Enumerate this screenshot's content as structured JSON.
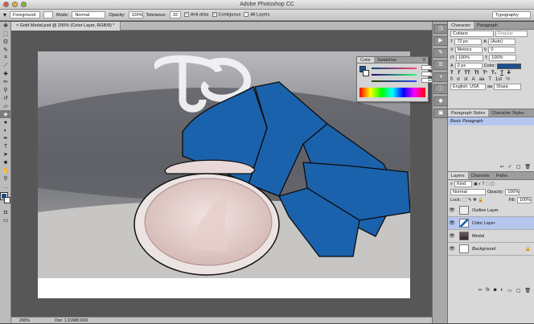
{
  "window": {
    "title": "Adobe Photoshop CC"
  },
  "options_bar": {
    "mode_preset": "Foreground",
    "mode_label": "Mode:",
    "mode_value": "Normal",
    "opacity_label": "Opacity:",
    "opacity_value": "100%",
    "tolerance_label": "Tolerance:",
    "tolerance_value": "32",
    "anti_alias": "Anti-alias",
    "contiguous": "Contiguous",
    "all_layers": "All Layers",
    "workspace": "Typography"
  },
  "document": {
    "tab_title": "Gold Medal.psd @ 200% (Color Layer, RGB/8) *",
    "zoom": "200%",
    "doc_size": "Doc: 1.91M/8.91M"
  },
  "color_panel": {
    "tabs": [
      "Color",
      "Swatches"
    ],
    "r": "38",
    "g": "71",
    "b": "120"
  },
  "character_panel": {
    "tabs": [
      "Character",
      "Paragraph"
    ],
    "font_family": "Cutiano",
    "font_style": "Regular",
    "font_size": "72 px",
    "leading": "(Auto)",
    "kerning": "Metrics",
    "tracking": "0",
    "vertical_scale": "100%",
    "horizontal_scale": "100%",
    "baseline": "0 px",
    "color_label": "Color:",
    "color_hex": "#1c4e8c",
    "language": "English: USA",
    "antialias": "Sharp"
  },
  "styles_panel": {
    "tabs": [
      "Paragraph Styles",
      "Character Styles"
    ],
    "item": "Basic Paragraph"
  },
  "layers_panel": {
    "tabs": [
      "Layers",
      "Channels",
      "Paths"
    ],
    "filter": "Kind",
    "blend_mode": "Normal",
    "opacity_label": "Opacity:",
    "opacity_value": "100%",
    "lock_label": "Lock:",
    "fill_label": "Fill:",
    "fill_value": "100%",
    "layers": [
      {
        "name": "Outline Layer",
        "selected": false
      },
      {
        "name": "Color Layer",
        "selected": true
      },
      {
        "name": "Medal",
        "selected": false
      },
      {
        "name": "Background",
        "selected": false
      }
    ]
  }
}
